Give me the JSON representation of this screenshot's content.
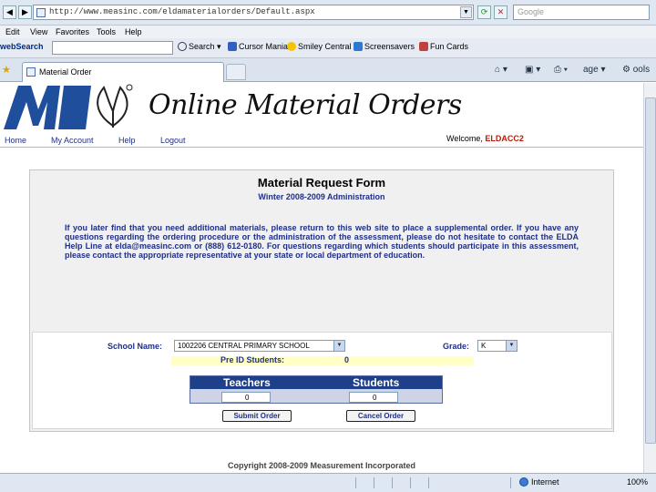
{
  "browser": {
    "url": "http://www.measinc.com/eldamaterialorders/Default.aspx",
    "search_placeholder": "Google",
    "menu": [
      "Edit",
      "View",
      "Favorites",
      "Tools",
      "Help"
    ],
    "toolbar": {
      "brand": "webSearch",
      "search_label": "Search",
      "items": [
        "Cursor Mania",
        "Smiley Central",
        "Screensavers",
        "Fun Cards"
      ]
    },
    "tab_title": "Material Order",
    "commands": {
      "page": "age",
      "tools": "ools"
    },
    "status": {
      "zone": "Internet",
      "zoom": "100%"
    }
  },
  "site": {
    "logo_text": "MI",
    "title": "Online Material Orders",
    "nav": [
      "Home",
      "My Account",
      "Help",
      "Logout"
    ],
    "welcome_label": "Welcome,",
    "welcome_user": "ELDACC2"
  },
  "form": {
    "title": "Material Request Form",
    "subtitle": "Winter 2008-2009 Administration",
    "instructions": "If you later find that you need additional materials, please return to this web site to place a supplemental order. If you have any questions regarding the ordering procedure or the administration of the assessment, please do not hesitate to contact the ELDA Help Line at elda@measinc.com or (888) 612-0180. For questions regarding which students should participate in this assessment, please contact the appropriate representative at your state or local department of education.",
    "school_label": "School Name:",
    "school_value": "1002206 CENTRAL PRIMARY SCHOOL",
    "grade_label": "Grade:",
    "grade_value": "K",
    "preid_label": "Pre ID Students:",
    "preid_value": "0",
    "teachers_label": "Teachers",
    "students_label": "Students",
    "teachers_value": "0",
    "students_value": "0",
    "submit_label": "Submit Order",
    "cancel_label": "Cancel Order"
  },
  "footer": "Copyright 2008-2009 Measurement Incorporated",
  "colors": {
    "brand_blue": "#1f2f86",
    "header_bar": "#1e3f8a",
    "highlight": "#ffffc6",
    "welcome_user": "#c21807"
  }
}
